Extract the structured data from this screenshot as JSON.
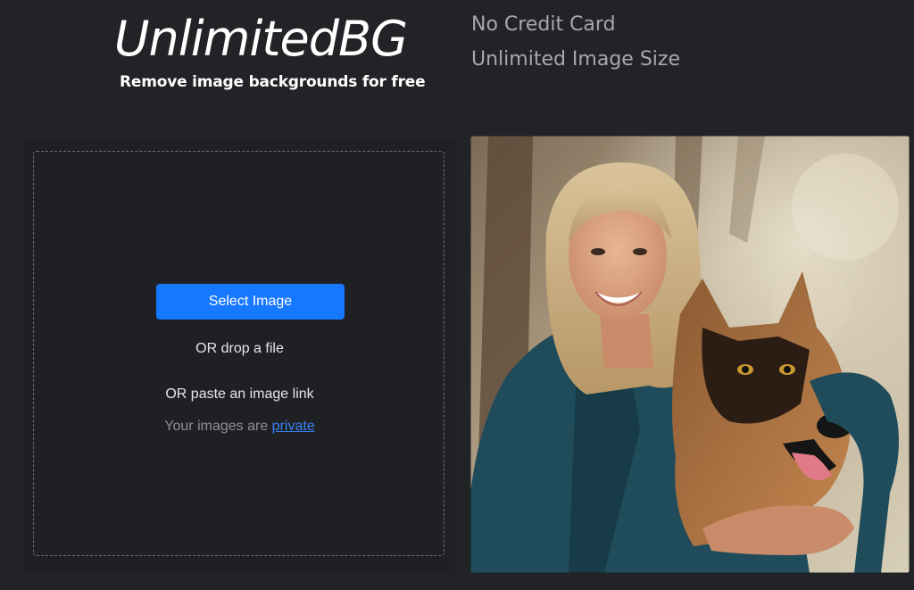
{
  "brand": {
    "logo": "UnlimitedBG",
    "tagline": "Remove image backgrounds for free"
  },
  "features": [
    "No Credit Card",
    "Unlimited Image Size"
  ],
  "upload": {
    "select_button": "Select Image",
    "drop_text": "OR drop a file",
    "paste_text": "OR paste an image link",
    "private_prefix": "Your images are",
    "private_link": "private"
  },
  "colors": {
    "background": "#222326",
    "panel": "#1f2024",
    "accent": "#1677ff",
    "link": "#3b82f6"
  },
  "preview": {
    "icon": "sample-photo-woman-with-dog"
  }
}
